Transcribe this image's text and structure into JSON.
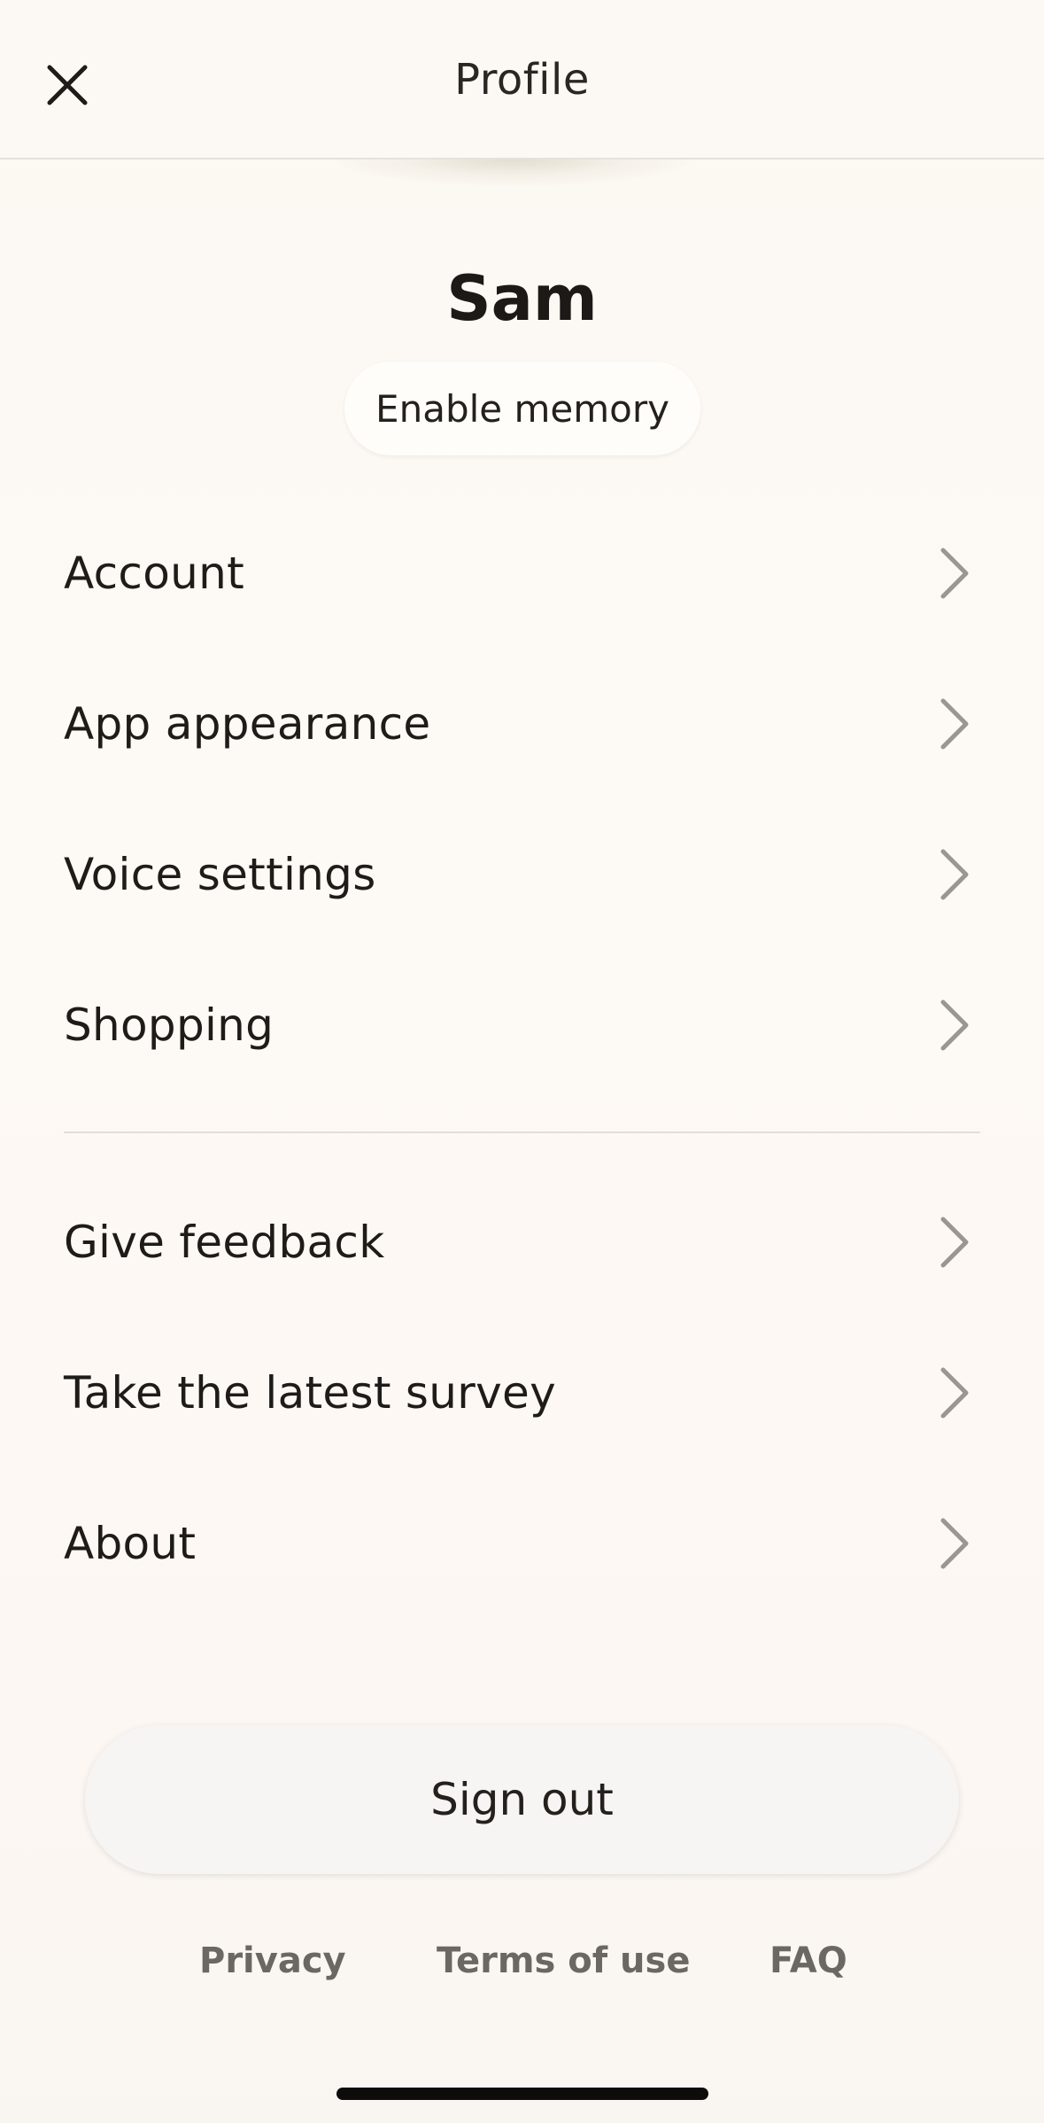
{
  "header": {
    "title": "Profile",
    "close_icon": "close-icon"
  },
  "profile": {
    "name": "Sam",
    "memory_button_label": "Enable memory"
  },
  "menu": {
    "primary": [
      {
        "label": "Account",
        "icon": "chevron-right-icon"
      },
      {
        "label": "App appearance",
        "icon": "chevron-right-icon"
      },
      {
        "label": "Voice settings",
        "icon": "chevron-right-icon"
      },
      {
        "label": "Shopping",
        "icon": "chevron-right-icon"
      }
    ],
    "secondary": [
      {
        "label": "Give feedback",
        "icon": "chevron-right-icon"
      },
      {
        "label": "Take the latest survey",
        "icon": "chevron-right-icon"
      },
      {
        "label": "About",
        "icon": "chevron-right-icon"
      }
    ]
  },
  "actions": {
    "sign_out_label": "Sign out"
  },
  "footer": {
    "privacy": "Privacy",
    "terms": "Terms of use",
    "faq": "FAQ"
  },
  "colors": {
    "background": "#fdf9f4",
    "text": "#1e1b18",
    "muted": "#6b6864",
    "chevron": "#9a9692"
  }
}
